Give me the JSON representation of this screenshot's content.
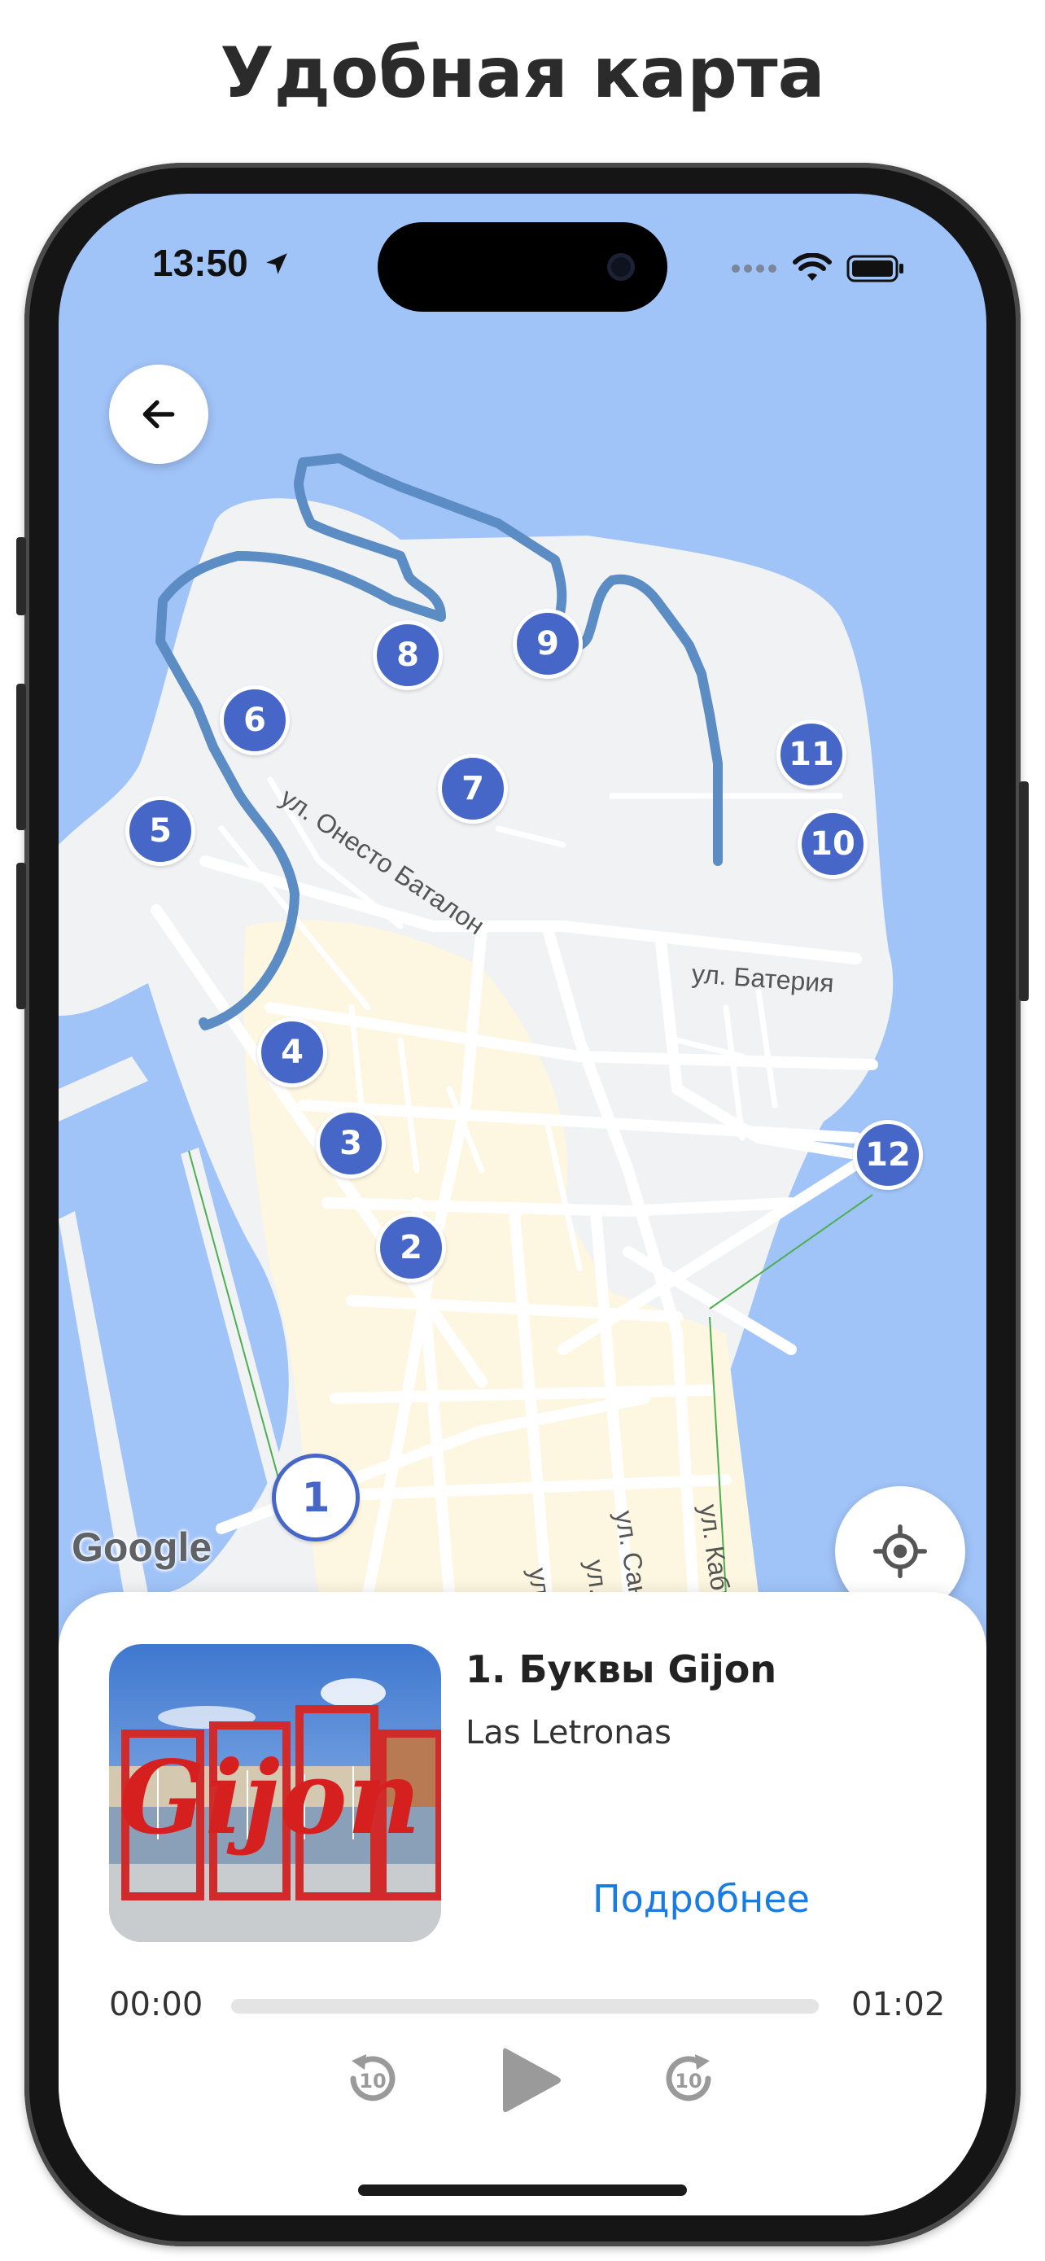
{
  "headline": "Удобная карта",
  "status_bar": {
    "time": "13:50"
  },
  "map": {
    "attribution": "Google",
    "streets": [
      "ул. Онесто Баталон",
      "ул. Батерия",
      "ул. Сан Р",
      "ул. Кабра",
      "ул. М",
      "ул. М"
    ],
    "stops": [
      "1",
      "2",
      "3",
      "4",
      "5",
      "6",
      "7",
      "8",
      "9",
      "10",
      "11",
      "12"
    ],
    "active_stop": "1",
    "colors": {
      "water": "#a0c3f8",
      "land": "#f1f2f4",
      "route": "#5b8dc4",
      "marker": "#4767c8"
    }
  },
  "player": {
    "title": "1. Буквы Gijon",
    "subtitle": "Las Letronas",
    "more_link": "Подробнее",
    "elapsed": "00:00",
    "duration": "01:02",
    "progress": 0,
    "skip_back": "10",
    "skip_forward": "10",
    "photo_text": "Gijon"
  }
}
